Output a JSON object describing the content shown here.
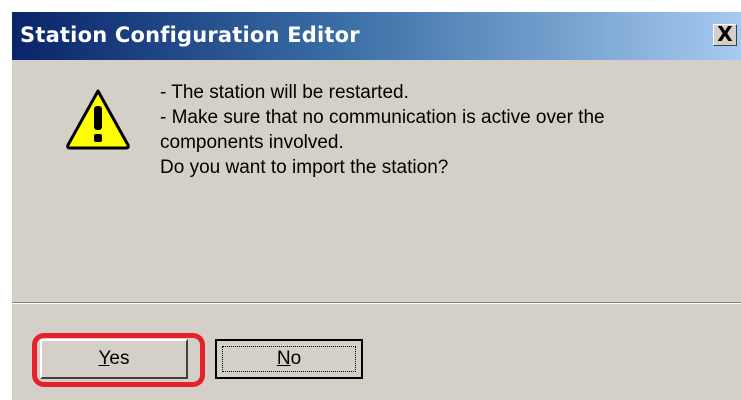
{
  "window": {
    "title": "Station Configuration Editor",
    "close_symbol": "X"
  },
  "message": {
    "icon": "warning-icon",
    "lines": [
      "- The station will be restarted.",
      "- Make sure that no communication is active over the",
      "components involved.",
      "Do you want to import the station?"
    ]
  },
  "buttons": {
    "yes": {
      "accel": "Y",
      "rest": "es"
    },
    "no": {
      "accel": "N",
      "rest": "o"
    }
  },
  "annotation": {
    "highlight_color": "#e8202a",
    "highlight_target": "Yes"
  },
  "colors": {
    "dialog_bg": "#d4d0c8",
    "titlebar_start": "#0a246a",
    "titlebar_end": "#a6caf0",
    "warning_yellow": "#ffff00"
  }
}
